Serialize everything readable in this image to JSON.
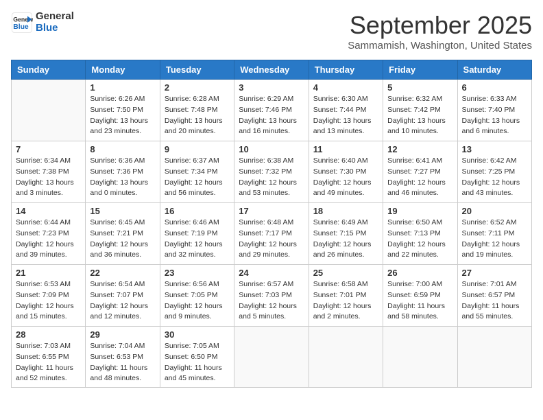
{
  "header": {
    "logo_line1": "General",
    "logo_line2": "Blue",
    "month": "September 2025",
    "location": "Sammamish, Washington, United States"
  },
  "days_of_week": [
    "Sunday",
    "Monday",
    "Tuesday",
    "Wednesday",
    "Thursday",
    "Friday",
    "Saturday"
  ],
  "weeks": [
    [
      {
        "day": "",
        "info": ""
      },
      {
        "day": "1",
        "info": "Sunrise: 6:26 AM\nSunset: 7:50 PM\nDaylight: 13 hours\nand 23 minutes."
      },
      {
        "day": "2",
        "info": "Sunrise: 6:28 AM\nSunset: 7:48 PM\nDaylight: 13 hours\nand 20 minutes."
      },
      {
        "day": "3",
        "info": "Sunrise: 6:29 AM\nSunset: 7:46 PM\nDaylight: 13 hours\nand 16 minutes."
      },
      {
        "day": "4",
        "info": "Sunrise: 6:30 AM\nSunset: 7:44 PM\nDaylight: 13 hours\nand 13 minutes."
      },
      {
        "day": "5",
        "info": "Sunrise: 6:32 AM\nSunset: 7:42 PM\nDaylight: 13 hours\nand 10 minutes."
      },
      {
        "day": "6",
        "info": "Sunrise: 6:33 AM\nSunset: 7:40 PM\nDaylight: 13 hours\nand 6 minutes."
      }
    ],
    [
      {
        "day": "7",
        "info": "Sunrise: 6:34 AM\nSunset: 7:38 PM\nDaylight: 13 hours\nand 3 minutes."
      },
      {
        "day": "8",
        "info": "Sunrise: 6:36 AM\nSunset: 7:36 PM\nDaylight: 13 hours\nand 0 minutes."
      },
      {
        "day": "9",
        "info": "Sunrise: 6:37 AM\nSunset: 7:34 PM\nDaylight: 12 hours\nand 56 minutes."
      },
      {
        "day": "10",
        "info": "Sunrise: 6:38 AM\nSunset: 7:32 PM\nDaylight: 12 hours\nand 53 minutes."
      },
      {
        "day": "11",
        "info": "Sunrise: 6:40 AM\nSunset: 7:30 PM\nDaylight: 12 hours\nand 49 minutes."
      },
      {
        "day": "12",
        "info": "Sunrise: 6:41 AM\nSunset: 7:27 PM\nDaylight: 12 hours\nand 46 minutes."
      },
      {
        "day": "13",
        "info": "Sunrise: 6:42 AM\nSunset: 7:25 PM\nDaylight: 12 hours\nand 43 minutes."
      }
    ],
    [
      {
        "day": "14",
        "info": "Sunrise: 6:44 AM\nSunset: 7:23 PM\nDaylight: 12 hours\nand 39 minutes."
      },
      {
        "day": "15",
        "info": "Sunrise: 6:45 AM\nSunset: 7:21 PM\nDaylight: 12 hours\nand 36 minutes."
      },
      {
        "day": "16",
        "info": "Sunrise: 6:46 AM\nSunset: 7:19 PM\nDaylight: 12 hours\nand 32 minutes."
      },
      {
        "day": "17",
        "info": "Sunrise: 6:48 AM\nSunset: 7:17 PM\nDaylight: 12 hours\nand 29 minutes."
      },
      {
        "day": "18",
        "info": "Sunrise: 6:49 AM\nSunset: 7:15 PM\nDaylight: 12 hours\nand 26 minutes."
      },
      {
        "day": "19",
        "info": "Sunrise: 6:50 AM\nSunset: 7:13 PM\nDaylight: 12 hours\nand 22 minutes."
      },
      {
        "day": "20",
        "info": "Sunrise: 6:52 AM\nSunset: 7:11 PM\nDaylight: 12 hours\nand 19 minutes."
      }
    ],
    [
      {
        "day": "21",
        "info": "Sunrise: 6:53 AM\nSunset: 7:09 PM\nDaylight: 12 hours\nand 15 minutes."
      },
      {
        "day": "22",
        "info": "Sunrise: 6:54 AM\nSunset: 7:07 PM\nDaylight: 12 hours\nand 12 minutes."
      },
      {
        "day": "23",
        "info": "Sunrise: 6:56 AM\nSunset: 7:05 PM\nDaylight: 12 hours\nand 9 minutes."
      },
      {
        "day": "24",
        "info": "Sunrise: 6:57 AM\nSunset: 7:03 PM\nDaylight: 12 hours\nand 5 minutes."
      },
      {
        "day": "25",
        "info": "Sunrise: 6:58 AM\nSunset: 7:01 PM\nDaylight: 12 hours\nand 2 minutes."
      },
      {
        "day": "26",
        "info": "Sunrise: 7:00 AM\nSunset: 6:59 PM\nDaylight: 11 hours\nand 58 minutes."
      },
      {
        "day": "27",
        "info": "Sunrise: 7:01 AM\nSunset: 6:57 PM\nDaylight: 11 hours\nand 55 minutes."
      }
    ],
    [
      {
        "day": "28",
        "info": "Sunrise: 7:03 AM\nSunset: 6:55 PM\nDaylight: 11 hours\nand 52 minutes."
      },
      {
        "day": "29",
        "info": "Sunrise: 7:04 AM\nSunset: 6:53 PM\nDaylight: 11 hours\nand 48 minutes."
      },
      {
        "day": "30",
        "info": "Sunrise: 7:05 AM\nSunset: 6:50 PM\nDaylight: 11 hours\nand 45 minutes."
      },
      {
        "day": "",
        "info": ""
      },
      {
        "day": "",
        "info": ""
      },
      {
        "day": "",
        "info": ""
      },
      {
        "day": "",
        "info": ""
      }
    ]
  ]
}
